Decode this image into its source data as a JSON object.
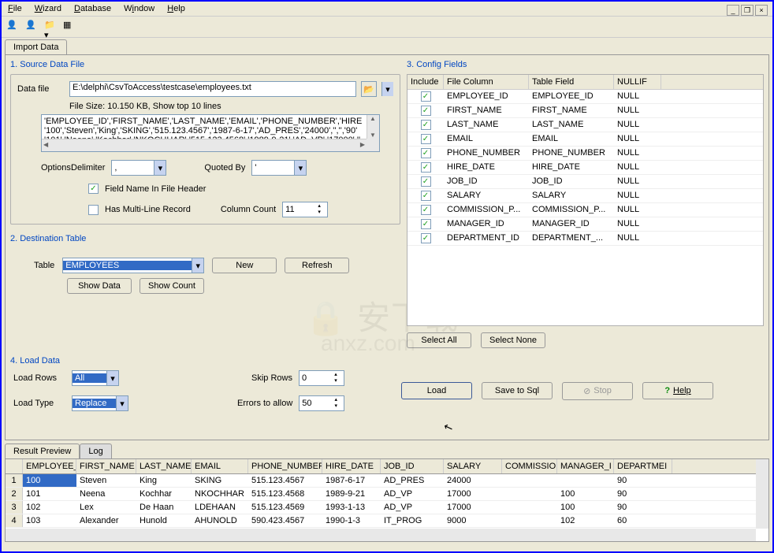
{
  "menu": {
    "file": "File",
    "wizard": "Wizard",
    "database": "Database",
    "window": "Window",
    "help": "Help"
  },
  "main_tab": "Import Data",
  "source": {
    "title": "1. Source Data File",
    "data_file_label": "Data file",
    "data_file_value": "E:\\delphi\\CsvToAccess\\testcase\\employees.txt",
    "file_info": "File Size: 10.150 KB,   Show top 10 lines",
    "preview_l1": "'EMPLOYEE_ID','FIRST_NAME','LAST_NAME','EMAIL','PHONE_NUMBER','HIRE",
    "preview_l2": "'100','Steven','King','SKING','515.123.4567','1987-6-17','AD_PRES','24000','','','90'",
    "preview_l3": "'101','Neena','Kochhar','NKOCHHAR','515.123.4568','1989-9-21','AD_VP','17000','',",
    "options_label": "Options:",
    "delimiter_label": "Delimiter",
    "delimiter_value": ",",
    "quoted_by_label": "Quoted By",
    "quoted_by_value": "'",
    "field_name_header": "Field Name In File Header",
    "multiline": "Has Multi-Line Record",
    "column_count_label": "Column Count",
    "column_count_value": "11"
  },
  "dest": {
    "title": "2. Destination Table",
    "table_label": "Table",
    "table_value": "EMPLOYEES",
    "new_btn": "New",
    "refresh_btn": "Refresh",
    "show_data": "Show Data",
    "show_count": "Show Count"
  },
  "config": {
    "title": "3. Config Fields",
    "h_include": "Include",
    "h_file": "File Column",
    "h_table": "Table Field",
    "h_null": "NULLIF",
    "rows": [
      {
        "file": "EMPLOYEE_ID",
        "table": "EMPLOYEE_ID",
        "null": "NULL"
      },
      {
        "file": "FIRST_NAME",
        "table": "FIRST_NAME",
        "null": "NULL"
      },
      {
        "file": "LAST_NAME",
        "table": "LAST_NAME",
        "null": "NULL"
      },
      {
        "file": "EMAIL",
        "table": "EMAIL",
        "null": "NULL"
      },
      {
        "file": "PHONE_NUMBER",
        "table": "PHONE_NUMBER",
        "null": "NULL"
      },
      {
        "file": "HIRE_DATE",
        "table": "HIRE_DATE",
        "null": "NULL"
      },
      {
        "file": "JOB_ID",
        "table": "JOB_ID",
        "null": "NULL"
      },
      {
        "file": "SALARY",
        "table": "SALARY",
        "null": "NULL"
      },
      {
        "file": "COMMISSION_P...",
        "table": "COMMISSION_P...",
        "null": "NULL"
      },
      {
        "file": "MANAGER_ID",
        "table": "MANAGER_ID",
        "null": "NULL"
      },
      {
        "file": "DEPARTMENT_ID",
        "table": "DEPARTMENT_...",
        "null": "NULL"
      }
    ],
    "select_all": "Select All",
    "select_none": "Select None"
  },
  "load": {
    "title": "4. Load Data",
    "load_rows_label": "Load Rows",
    "load_rows_value": "All",
    "load_type_label": "Load Type",
    "load_type_value": "Replace",
    "skip_rows_label": "Skip Rows",
    "skip_rows_value": "0",
    "errors_label": "Errors to allow",
    "errors_value": "50",
    "load_btn": "Load",
    "save_sql": "Save to Sql",
    "stop": "Stop",
    "help": "Help"
  },
  "result": {
    "tab_preview": "Result Preview",
    "tab_log": "Log",
    "headers": [
      "EMPLOYEE_",
      "FIRST_NAME",
      "LAST_NAME",
      "EMAIL",
      "PHONE_NUMBER",
      "HIRE_DATE",
      "JOB_ID",
      "SALARY",
      "COMMISSIO",
      "MANAGER_I",
      "DEPARTMEI"
    ],
    "rows": [
      {
        "n": "1",
        "c": [
          "100",
          "Steven",
          "King",
          "SKING",
          "515.123.4567",
          "1987-6-17",
          "AD_PRES",
          "24000",
          "",
          "",
          "90"
        ]
      },
      {
        "n": "2",
        "c": [
          "101",
          "Neena",
          "Kochhar",
          "NKOCHHAR",
          "515.123.4568",
          "1989-9-21",
          "AD_VP",
          "17000",
          "",
          "100",
          "90"
        ]
      },
      {
        "n": "3",
        "c": [
          "102",
          "Lex",
          "De Haan",
          "LDEHAAN",
          "515.123.4569",
          "1993-1-13",
          "AD_VP",
          "17000",
          "",
          "100",
          "90"
        ]
      },
      {
        "n": "4",
        "c": [
          "103",
          "Alexander",
          "Hunold",
          "AHUNOLD",
          "590.423.4567",
          "1990-1-3",
          "IT_PROG",
          "9000",
          "",
          "102",
          "60"
        ]
      }
    ]
  }
}
